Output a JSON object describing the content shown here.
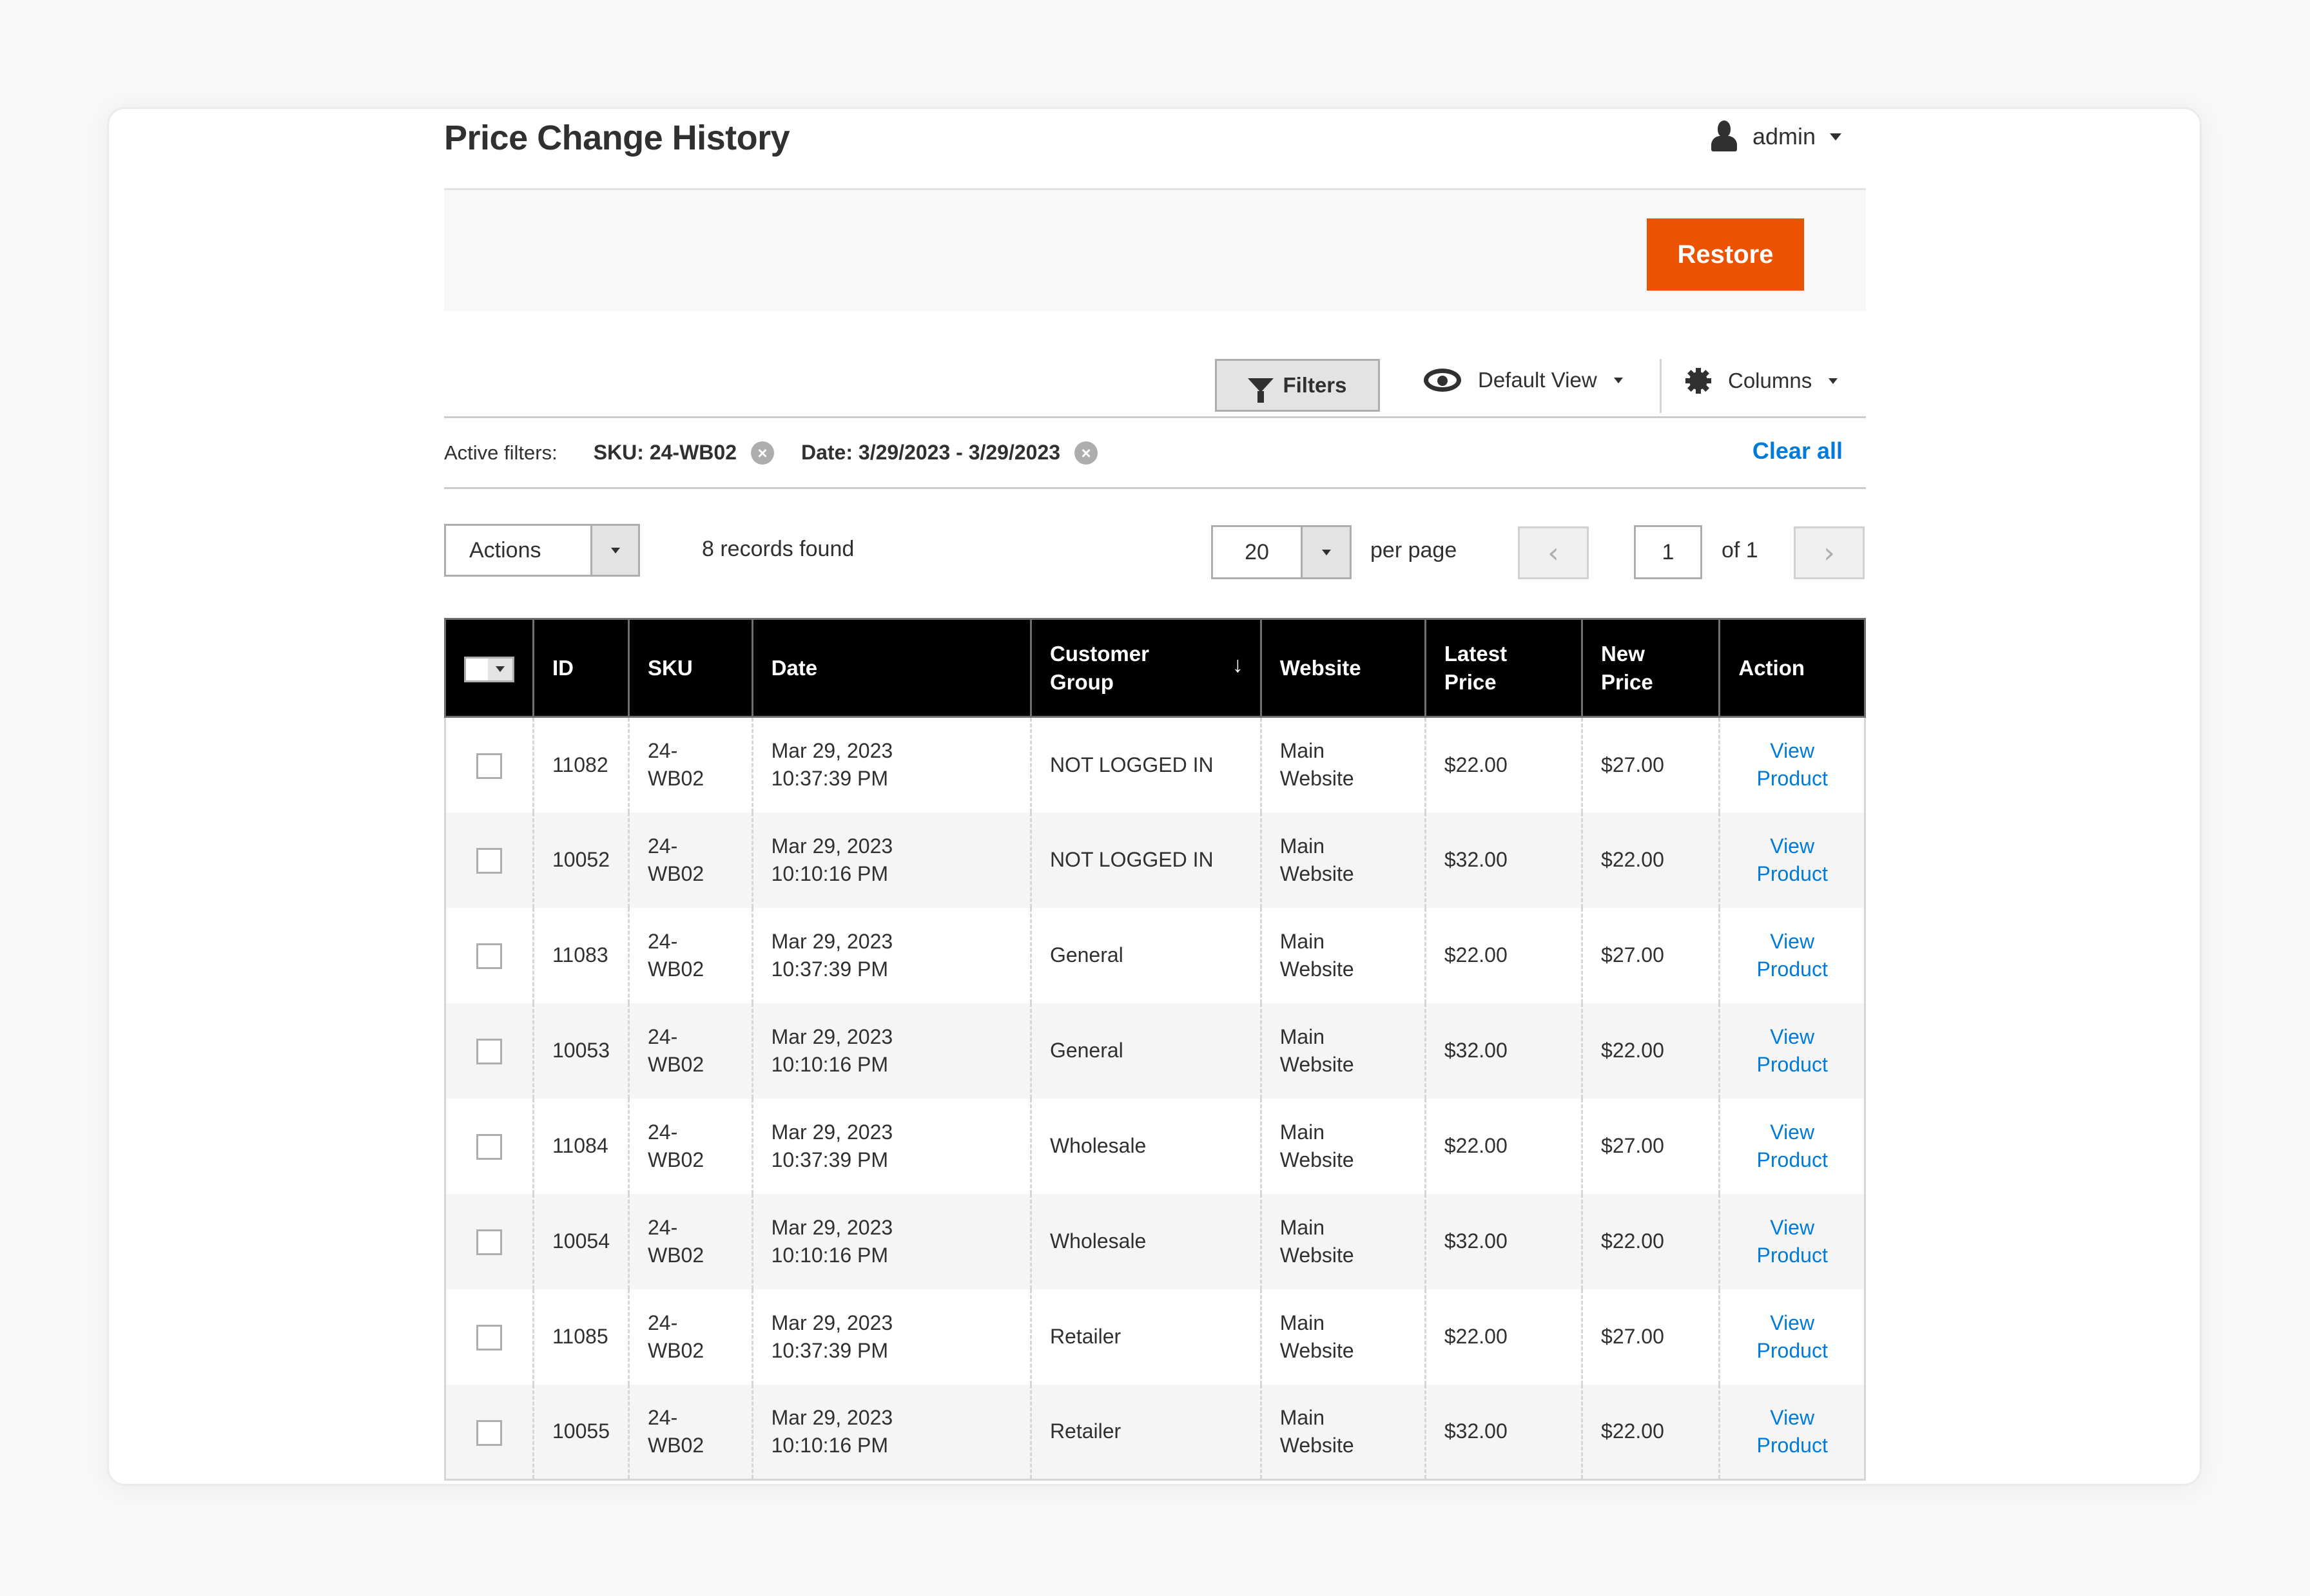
{
  "header": {
    "title": "Price Change History",
    "user_name": "admin"
  },
  "action_bar": {
    "restore_label": "Restore",
    "restore_color": "#eb5202"
  },
  "controls": {
    "filters_label": "Filters",
    "view_label": "Default View",
    "columns_label": "Columns"
  },
  "active_filters": {
    "label": "Active filters:",
    "chips": [
      {
        "text": "SKU: 24-WB02",
        "remove_icon": "close-circle-icon"
      },
      {
        "text": "Date: 3/29/2023 - 3/29/2023",
        "remove_icon": "close-circle-icon"
      }
    ],
    "clear_all_label": "Clear all",
    "remove_glyph": "×"
  },
  "toolbar": {
    "actions_label": "Actions",
    "records_found": "8 records found",
    "per_page_value": "20",
    "per_page_label": "per page",
    "page_value": "1",
    "page_of": "of 1",
    "prev_glyph": "‹",
    "next_glyph": "›"
  },
  "table": {
    "columns": {
      "id": "ID",
      "sku": "SKU",
      "date": "Date",
      "customer_group": "Customer Group",
      "website": "Website",
      "latest_price": "Latest Price",
      "new_price": "New Price",
      "action": "Action"
    },
    "sort_indicator": "↓",
    "sorted_column": "customer_group",
    "rows": [
      {
        "id": "11082",
        "sku": "24-WB02",
        "date": "Mar 29, 2023 10:37:39 PM",
        "customer_group": "NOT LOGGED IN",
        "website": "Main Website",
        "latest_price": "$22.00",
        "new_price": "$27.00",
        "action": "View Product"
      },
      {
        "id": "10052",
        "sku": "24-WB02",
        "date": "Mar 29, 2023 10:10:16 PM",
        "customer_group": "NOT LOGGED IN",
        "website": "Main Website",
        "latest_price": "$32.00",
        "new_price": "$22.00",
        "action": "View Product"
      },
      {
        "id": "11083",
        "sku": "24-WB02",
        "date": "Mar 29, 2023 10:37:39 PM",
        "customer_group": "General",
        "website": "Main Website",
        "latest_price": "$22.00",
        "new_price": "$27.00",
        "action": "View Product"
      },
      {
        "id": "10053",
        "sku": "24-WB02",
        "date": "Mar 29, 2023 10:10:16 PM",
        "customer_group": "General",
        "website": "Main Website",
        "latest_price": "$32.00",
        "new_price": "$22.00",
        "action": "View Product"
      },
      {
        "id": "11084",
        "sku": "24-WB02",
        "date": "Mar 29, 2023 10:37:39 PM",
        "customer_group": "Wholesale",
        "website": "Main Website",
        "latest_price": "$22.00",
        "new_price": "$27.00",
        "action": "View Product"
      },
      {
        "id": "10054",
        "sku": "24-WB02",
        "date": "Mar 29, 2023 10:10:16 PM",
        "customer_group": "Wholesale",
        "website": "Main Website",
        "latest_price": "$32.00",
        "new_price": "$22.00",
        "action": "View Product"
      },
      {
        "id": "11085",
        "sku": "24-WB02",
        "date": "Mar 29, 2023 10:37:39 PM",
        "customer_group": "Retailer",
        "website": "Main Website",
        "latest_price": "$22.00",
        "new_price": "$27.00",
        "action": "View Product"
      },
      {
        "id": "10055",
        "sku": "24-WB02",
        "date": "Mar 29, 2023 10:10:16 PM",
        "customer_group": "Retailer",
        "website": "Main Website",
        "latest_price": "$32.00",
        "new_price": "$22.00",
        "action": "View Product"
      }
    ]
  },
  "colors": {
    "accent_orange": "#eb5202",
    "link_blue": "#007bdb",
    "header_black": "#000000"
  }
}
